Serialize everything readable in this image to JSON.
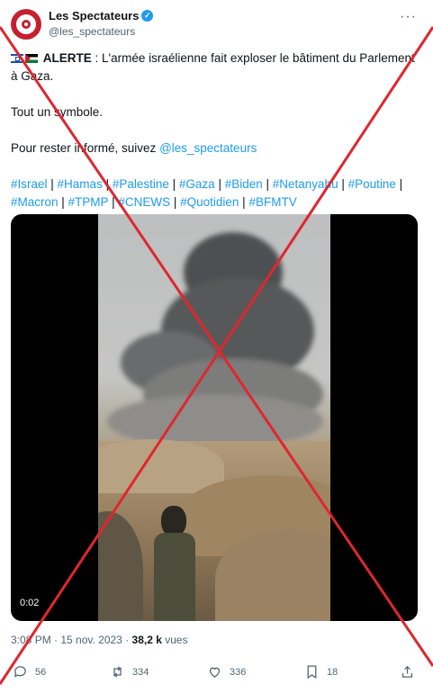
{
  "author": {
    "display_name": "Les Spectateurs",
    "handle": "@les_spectateurs"
  },
  "tweet": {
    "alert_label": "ALERTE",
    "line1": " : L'armée israélienne fait exploser le bâtiment du Parlement à Gaza.",
    "line2": "Tout un symbole.",
    "line3_prefix": "Pour rester informé, suivez ",
    "line3_mention": "@les_spectateurs",
    "hashtags": [
      "#Israel",
      "#Hamas",
      "#Palestine",
      "#Gaza",
      "#Biden",
      "#Netanyahu",
      "#Poutine",
      "#Macron",
      "#TPMP",
      "#CNEWS",
      "#Quotidien",
      "#BFMTV"
    ],
    "separator": " | "
  },
  "video": {
    "elapsed": "0:02"
  },
  "meta": {
    "time_date": "3:08 PM · 15 nov. 2023 · ",
    "views_count": "38,2 k",
    "views_label": " vues"
  },
  "actions": {
    "replies": "56",
    "reposts": "334",
    "likes": "336",
    "bookmarks": "18"
  },
  "overlay": {
    "cross_color": "#e0262f"
  }
}
